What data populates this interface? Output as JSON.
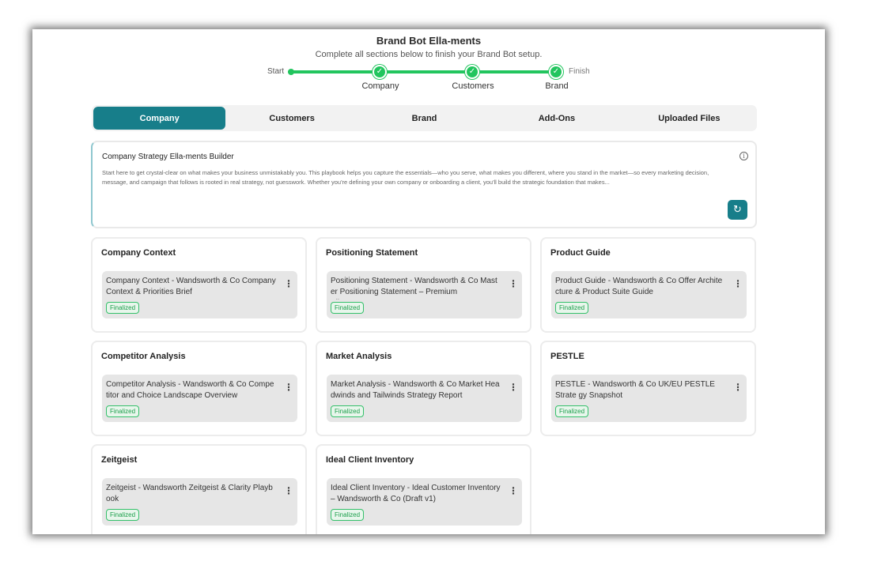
{
  "header": {
    "title": "Brand Bot Ella-ments",
    "subtitle": "Complete all sections below to finish your Brand Bot setup."
  },
  "progress": {
    "start_label": "Start",
    "finish_label": "Finish",
    "steps": [
      {
        "label": "Company",
        "status": "complete"
      },
      {
        "label": "Customers",
        "status": "complete"
      },
      {
        "label": "Brand",
        "status": "complete"
      }
    ]
  },
  "tabs": [
    {
      "label": "Company",
      "active": true
    },
    {
      "label": "Customers",
      "active": false
    },
    {
      "label": "Brand",
      "active": false
    },
    {
      "label": "Add-Ons",
      "active": false
    },
    {
      "label": "Uploaded Files",
      "active": false
    }
  ],
  "intro": {
    "title": "Company Strategy Ella-ments Builder",
    "text": "Start here to get crystal-clear on what makes your business unmistakably you. This playbook helps you capture the essentials—who you serve, what makes you different, where you stand in the market—so every marketing decision, message, and campaign that follows is rooted in real strategy, not guesswork. Whether you're defining your own company or onboarding a client, you'll build the strategic foundation that makes..."
  },
  "cards": [
    {
      "title": "Company Context",
      "doc": "Company Context - Wandsworth & Co Company Context & Priorities Brief",
      "status": "Finalized"
    },
    {
      "title": "Positioning Statement",
      "doc": "Positioning Statement - Wandsworth & Co Mast er Positioning Statement – Premium Alignment...",
      "status": "Finalized"
    },
    {
      "title": "Product Guide",
      "doc": "Product Guide - Wandsworth & Co Offer Archite cture & Product Suite Guide",
      "status": "Finalized"
    },
    {
      "title": "Competitor Analysis",
      "doc": "Competitor Analysis - Wandsworth & Co Compe titor and Choice Landscape Overview",
      "status": "Finalized"
    },
    {
      "title": "Market Analysis",
      "doc": "Market Analysis - Wandsworth & Co Market Hea dwinds and Tailwinds Strategy Report",
      "status": "Finalized"
    },
    {
      "title": "PESTLE",
      "doc": "PESTLE - Wandsworth & Co UK/EU PESTLE Strate gy Snapshot",
      "status": "Finalized"
    },
    {
      "title": "Zeitgeist",
      "doc": "Zeitgeist - Wandsworth Zeitgeist & Clarity Playb ook",
      "status": "Finalized"
    },
    {
      "title": "Ideal Client Inventory",
      "doc": "Ideal Client Inventory - Ideal Customer Inventory – Wandsworth & Co (Draft v1)",
      "status": "Finalized"
    }
  ],
  "colors": {
    "accent": "#177e8a",
    "progress": "#22c55e",
    "finalized": "#1a9e4a"
  },
  "icons": {
    "info": "info-icon",
    "refresh": "refresh-icon",
    "menu": "kebab-menu-icon",
    "check": "check-icon"
  }
}
